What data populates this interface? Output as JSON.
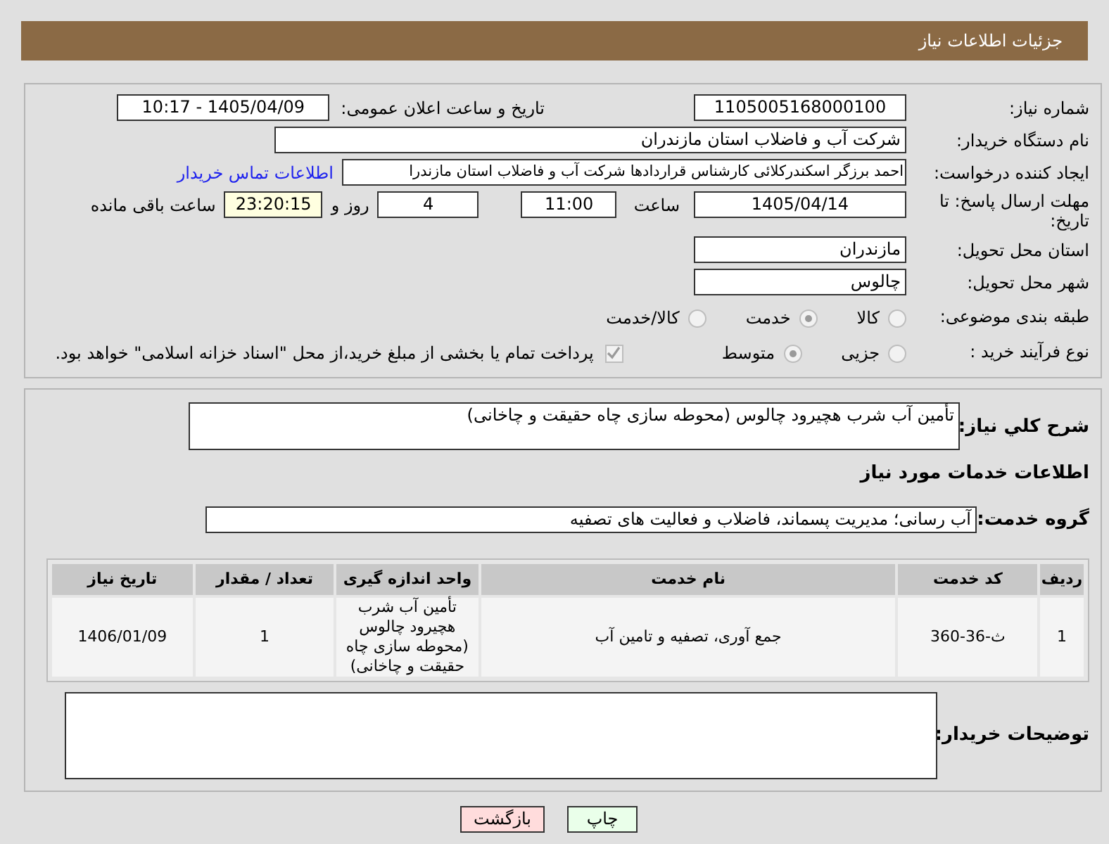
{
  "header": {
    "title": "جزئیات اطلاعات نیاز"
  },
  "need_number": {
    "label": "شماره نیاز:",
    "value": "1105005168000100"
  },
  "announce": {
    "label": "تاریخ و ساعت اعلان عمومی:",
    "value": "1405/04/09 - 10:17"
  },
  "buyer_org": {
    "label": "نام دستگاه خریدار:",
    "value": "شرکت آب و فاضلاب استان مازندران"
  },
  "requester": {
    "label": "ایجاد کننده درخواست:",
    "value": "احمد برزگر اسکندرکلائی کارشناس قراردادها شرکت آب و فاضلاب استان مازندرا",
    "link": "اطلاعات تماس خریدار"
  },
  "deadline": {
    "label": "مهلت ارسال پاسخ: تا تاریخ:",
    "date": "1405/04/14",
    "time_label": "ساعت",
    "time": "11:00",
    "days": "4",
    "days_label": "روز و",
    "remaining": "23:20:15",
    "remaining_label": "ساعت باقی مانده"
  },
  "province": {
    "label": "استان محل تحویل:",
    "value": "مازندران"
  },
  "city": {
    "label": "شهر محل تحویل:",
    "value": "چالوس"
  },
  "category": {
    "label": "طبقه بندی موضوعی:",
    "options": [
      {
        "label": "کالا",
        "selected": false
      },
      {
        "label": "خدمت",
        "selected": true
      },
      {
        "label": "کالا/خدمت",
        "selected": false
      }
    ]
  },
  "purchase_type": {
    "label": "نوع فرآیند خرید :",
    "options": [
      {
        "label": "جزیی",
        "selected": false
      },
      {
        "label": "متوسط",
        "selected": true
      }
    ],
    "payment": {
      "checked": true,
      "text": "پرداخت تمام یا بخشی از مبلغ خرید،از محل \"اسناد خزانه اسلامی\" خواهد بود."
    }
  },
  "description": {
    "label": "شرح کلي نياز:",
    "value": "تأمین آب شرب هچیرود چالوس (محوطه سازی چاه حقیقت و چاخانی)"
  },
  "services_title": "اطلاعات خدمات مورد نیاز",
  "service_group": {
    "label": "گروه خدمت:",
    "value": "آب رسانی؛ مدیریت پسماند، فاضلاب و فعالیت های تصفیه"
  },
  "table": {
    "columns": [
      "ردیف",
      "کد خدمت",
      "نام خدمت",
      "واحد اندازه گیری",
      "تعداد / مقدار",
      "تاریخ نیاز"
    ],
    "rows": [
      [
        "1",
        "ث-36-360",
        "جمع آوری، تصفیه و تامین آب",
        "تأمین آب شرب هچیرود چالوس (محوطه سازی چاه حقیقت و چاخانی)",
        "1",
        "1406/01/09"
      ]
    ]
  },
  "buyer_notes": {
    "label": "توضیحات خریدار:"
  },
  "buttons": [
    {
      "label": "چاپ",
      "kind": "print"
    },
    {
      "label": "بازگشت",
      "kind": "back"
    }
  ]
}
